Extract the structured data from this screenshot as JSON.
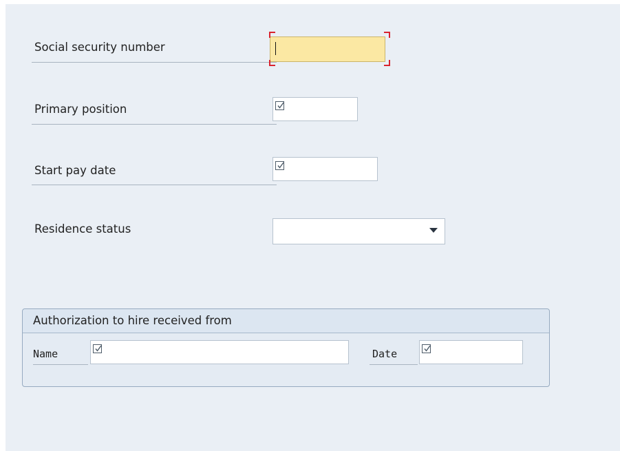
{
  "form": {
    "fields": [
      {
        "label": "Social security number",
        "value": "",
        "focused": true,
        "required": false
      },
      {
        "label": "Primary position",
        "value": "",
        "required": true
      },
      {
        "label": "Start pay date",
        "value": "",
        "required": true
      },
      {
        "label": "Residence status",
        "value": "",
        "type": "dropdown"
      }
    ]
  },
  "group": {
    "title": "Authorization to hire received from",
    "name_label": "Name",
    "name_value": "",
    "date_label": "Date",
    "date_value": ""
  },
  "colors": {
    "background": "#eaeff5",
    "focus_fill": "#fbe8a3",
    "focus_corners": "#d9232e",
    "group_border": "#96aac0"
  },
  "icons": {
    "required": "required-checkbox-icon",
    "dropdown": "chevron-down-icon"
  }
}
